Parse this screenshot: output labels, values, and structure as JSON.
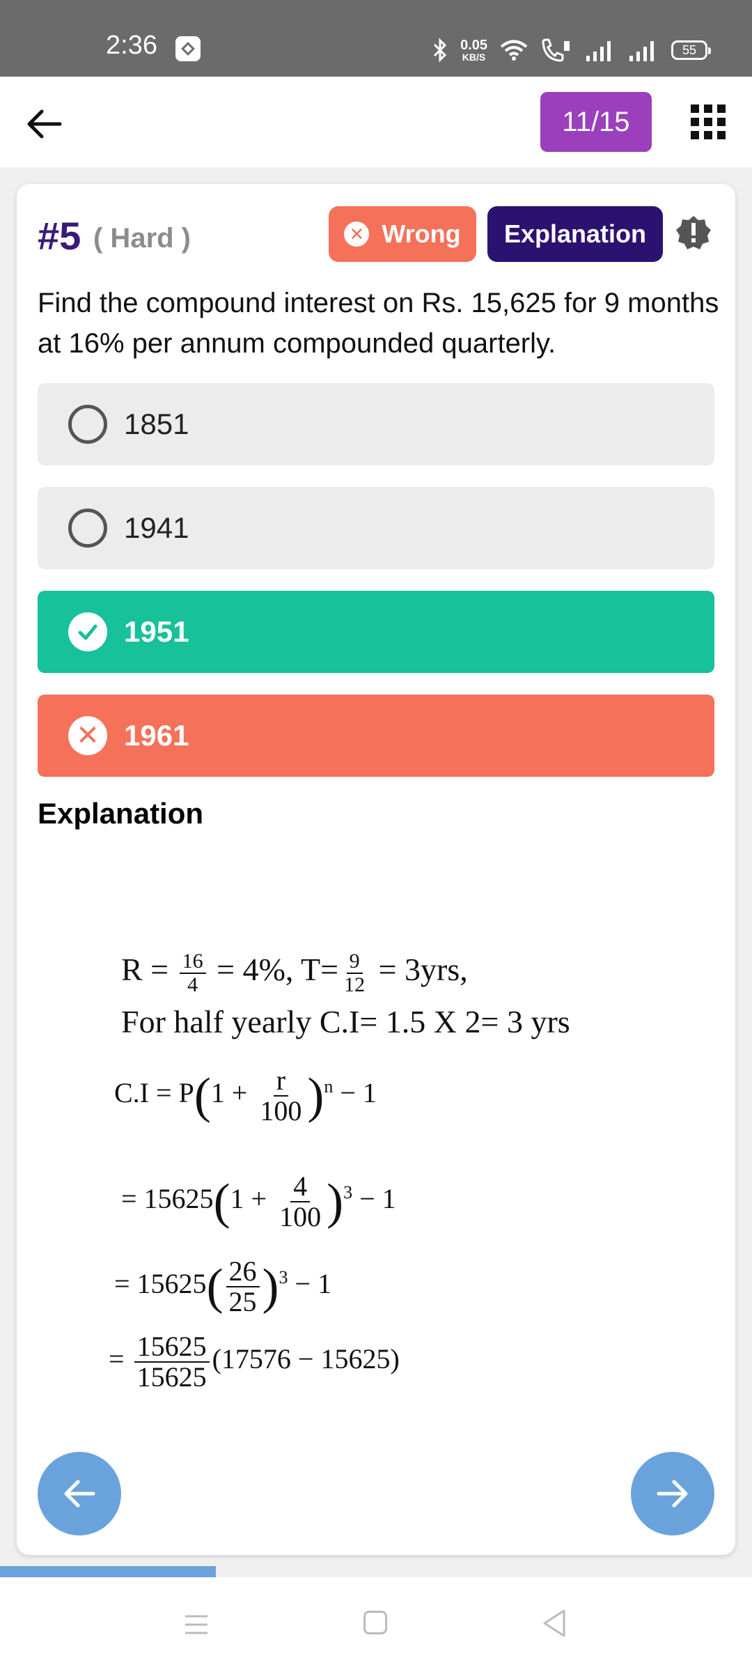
{
  "status_bar": {
    "time": "2:36",
    "net_speed_value": "0.05",
    "net_speed_unit": "KB/S",
    "battery": "55"
  },
  "app_bar": {
    "progress_counter": "11/15",
    "icons": [
      "back-arrow-icon",
      "grid-menu-icon"
    ]
  },
  "question": {
    "number": "#5",
    "difficulty": "( Hard )",
    "result_label": "Wrong",
    "explanation_button": "Explanation",
    "text": "Find the compound interest on Rs. 15,625 for 9 months at 16% per annum compounded quarterly.",
    "options": [
      {
        "label": "1851",
        "state": "unselected"
      },
      {
        "label": "1941",
        "state": "unselected"
      },
      {
        "label": "1951",
        "state": "correct"
      },
      {
        "label": "1961",
        "state": "wrong"
      }
    ]
  },
  "explanation": {
    "heading": "Explanation",
    "line1_a": "R = ",
    "line1_frac1_num": "16",
    "line1_frac1_den": "4",
    "line1_b": " = 4%, T=",
    "line1_frac2_num": "9",
    "line1_frac2_den": "12",
    "line1_c": " = 3yrs,",
    "line2": "For half yearly C.I= 1.5 X 2= 3 yrs",
    "line3_a": "C.I  =  P",
    "line3_paren_open": "(",
    "line3_one": "1 + ",
    "line3_frac_num": "r",
    "line3_frac_den": "100",
    "line3_paren_close": ")",
    "line3_exp": "n",
    "line3_tail": " − 1",
    "line4_a": "=  15625",
    "line4_paren_open": "(",
    "line4_one": "1 + ",
    "line4_frac_num": "4",
    "line4_frac_den": "100",
    "line4_paren_close": ")",
    "line4_exp": "3",
    "line4_tail": " − 1",
    "line5_a": "=  15625",
    "line5_paren_open": "(",
    "line5_frac_num": "26",
    "line5_frac_den": "25",
    "line5_paren_close": ")",
    "line5_exp": "3",
    "line5_tail": " − 1",
    "line6_a": "= ",
    "line6_frac_num": "15625",
    "line6_frac_den": "15625",
    "line6_tail": "(17576 − 15625)"
  },
  "quiz_progress_fraction": 0.287,
  "colors": {
    "counter_bg": "#9b3fbd",
    "wrong": "#f5715a",
    "correct": "#17c19a",
    "explanation_btn": "#2b1270",
    "nav_button": "#6aa3dc"
  }
}
